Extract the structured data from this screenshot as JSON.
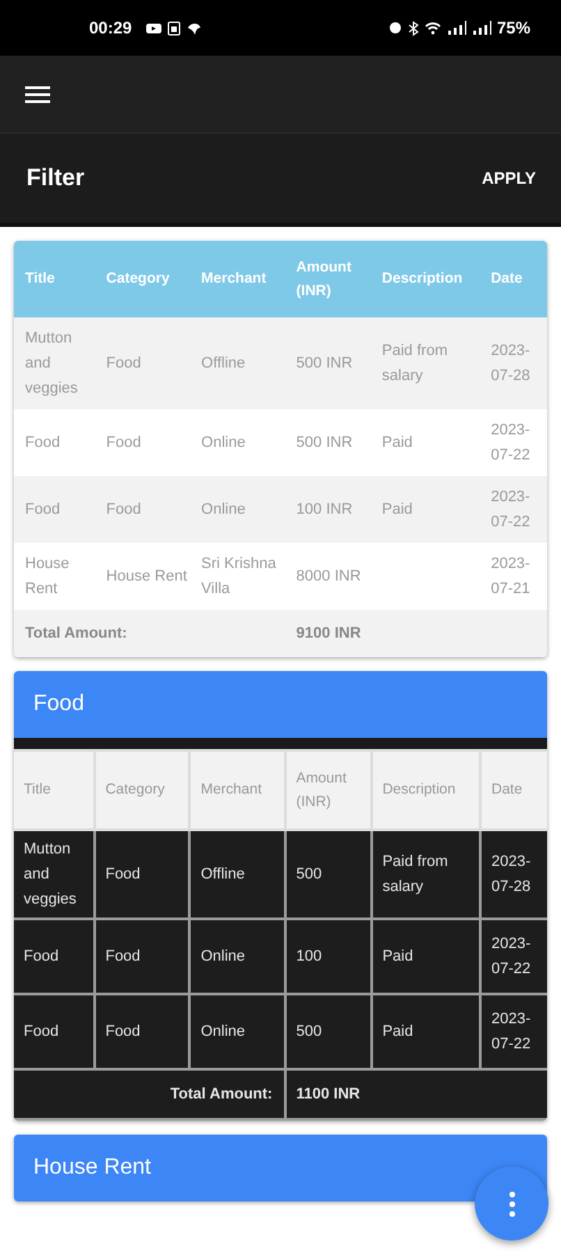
{
  "status_bar": {
    "time": "00:29",
    "battery": "75%"
  },
  "filter_bar": {
    "title": "Filter",
    "action": "APPLY"
  },
  "summary_table": {
    "columns": [
      "Title",
      "Category",
      "Merchant",
      "Amount (INR)",
      "Description",
      "Date"
    ],
    "rows": [
      {
        "cells": [
          "Mutton and veggies",
          "Food",
          "Offline",
          "500 INR",
          "Paid from salary",
          "2023-07-28"
        ]
      },
      {
        "cells": [
          "Food",
          "Food",
          "Online",
          "500 INR",
          "Paid",
          "2023-07-22"
        ]
      },
      {
        "cells": [
          "Food",
          "Food",
          "Online",
          "100 INR",
          "Paid",
          "2023-07-22"
        ]
      },
      {
        "cells": [
          "House Rent",
          "House Rent",
          "Sri Krishna Villa",
          "8000 INR",
          "",
          "2023-07-21"
        ]
      }
    ],
    "total_label": "Total Amount:",
    "total_value": "9100 INR"
  },
  "groups": [
    {
      "title": "Food",
      "columns": [
        "Title",
        "Category",
        "Merchant",
        "Amount (INR)",
        "Description",
        "Date"
      ],
      "rows": [
        {
          "cells": [
            "Mutton and veggies",
            "Food",
            "Offline",
            "500",
            "Paid from salary",
            "2023-07-28"
          ]
        },
        {
          "cells": [
            "Food",
            "Food",
            "Online",
            "100",
            "Paid",
            "2023-07-22"
          ]
        },
        {
          "cells": [
            "Food",
            "Food",
            "Online",
            "500",
            "Paid",
            "2023-07-22"
          ]
        }
      ],
      "total_label": "Total Amount:",
      "total_value": "1100 INR"
    },
    {
      "title": "House Rent"
    }
  ]
}
